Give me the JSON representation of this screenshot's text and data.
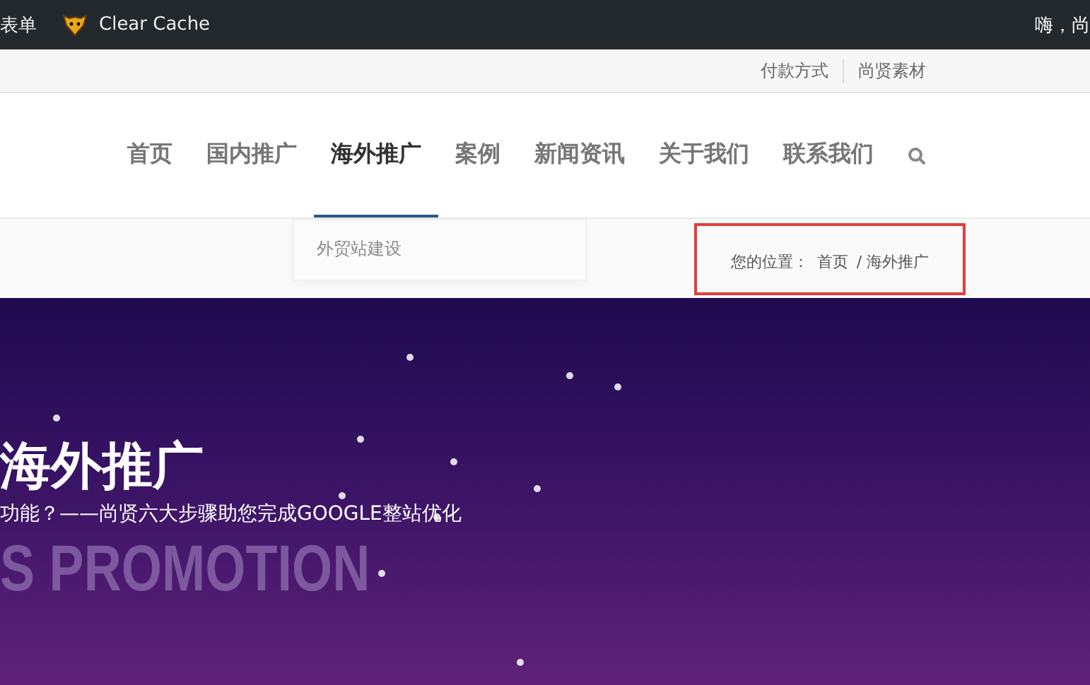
{
  "admin_bar": {
    "left_items": [
      {
        "kind": "text",
        "label": "表单"
      },
      {
        "kind": "plugin",
        "label": "Clear Cache"
      }
    ],
    "greeting": "嗨，尚"
  },
  "top_links": [
    "付款方式",
    "尚贤素材"
  ],
  "nav": [
    {
      "label": "首页",
      "selected": false
    },
    {
      "label": "国内推广",
      "selected": false
    },
    {
      "label": "海外推广",
      "selected": true
    },
    {
      "label": "案例",
      "selected": false
    },
    {
      "label": "新闻资讯",
      "selected": false
    },
    {
      "label": "关于我们",
      "selected": false
    },
    {
      "label": "联系我们",
      "selected": false
    }
  ],
  "dropdown": {
    "items": [
      "外贸站建设"
    ]
  },
  "breadcrumb": {
    "prefix": "您的位置：",
    "items": [
      "首页",
      "/ 海外推广"
    ]
  },
  "banner": {
    "title": "海外推广",
    "subtitle": "功能？——尚贤六大步骤助您完成GOOGLE整站优化",
    "watermark": "S PROMOTION"
  }
}
